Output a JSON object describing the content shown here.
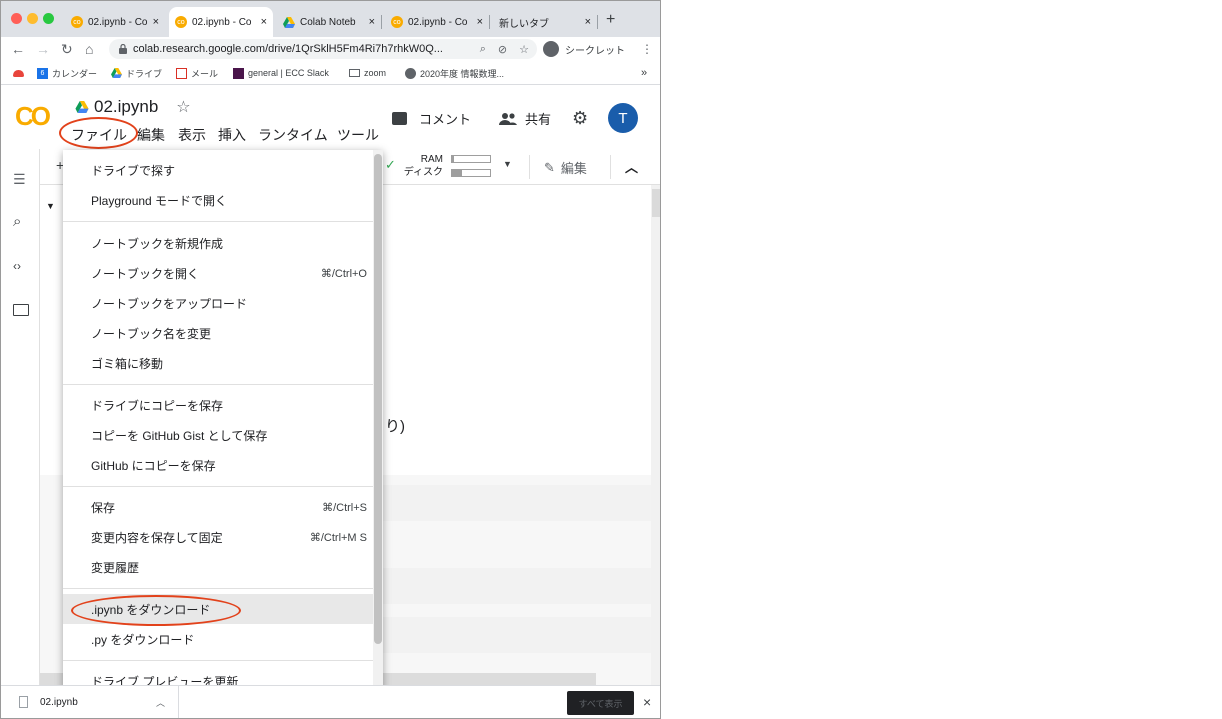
{
  "tabs": [
    {
      "title": "02.ipynb - Co",
      "favicon": "colab-icon",
      "active": false
    },
    {
      "title": "02.ipynb - Co",
      "favicon": "colab-icon",
      "active": true
    },
    {
      "title": "Colab Noteb",
      "favicon": "drive-icon",
      "active": false
    },
    {
      "title": "02.ipynb - Co",
      "favicon": "colab-icon",
      "active": false
    },
    {
      "title": "新しいタブ",
      "favicon": "",
      "active": false
    }
  ],
  "tab_close": "×",
  "new_tab": "+",
  "address": {
    "url": "colab.research.google.com/drive/1QrSklH5Fm4Ri7h7rhkW0Q...",
    "profile_label": "シークレット"
  },
  "bookmarks": [
    {
      "label": "",
      "icon": "cloud-icon"
    },
    {
      "label": "カレンダー",
      "icon": "calendar-icon"
    },
    {
      "label": "ドライブ",
      "icon": "drive-icon"
    },
    {
      "label": "メール",
      "icon": "gmail-icon"
    },
    {
      "label": "general | ECC Slack",
      "icon": "slack-icon"
    },
    {
      "label": "zoom",
      "icon": "folder-icon"
    },
    {
      "label": "2020年度 情報数理...",
      "icon": "globe-icon"
    }
  ],
  "bookmarks_more": "»",
  "colab": {
    "logo": "CO",
    "notebook_title": "02.ipynb",
    "menus": [
      "ファイル",
      "編集",
      "表示",
      "挿入",
      "ランタイム",
      "ツール"
    ],
    "comment_label": "コメント",
    "share_label": "共有",
    "avatar_letter": "T"
  },
  "toolbar": {
    "add": "+",
    "ram_label": "RAM",
    "disk_label": "ディスク",
    "edit_label": "編集"
  },
  "partial_text": "り)",
  "file_menu": {
    "items": [
      {
        "label": "ドライブで探す",
        "shortcut": ""
      },
      {
        "label": "Playground モードで開く",
        "shortcut": ""
      },
      {
        "label": "ノートブックを新規作成",
        "shortcut": ""
      },
      {
        "label": "ノートブックを開く",
        "shortcut": "⌘/Ctrl+O"
      },
      {
        "label": "ノートブックをアップロード",
        "shortcut": ""
      },
      {
        "label": "ノートブック名を変更",
        "shortcut": ""
      },
      {
        "label": "ゴミ箱に移動",
        "shortcut": ""
      },
      {
        "label": "ドライブにコピーを保存",
        "shortcut": ""
      },
      {
        "label": "コピーを GitHub Gist として保存",
        "shortcut": ""
      },
      {
        "label": "GitHub にコピーを保存",
        "shortcut": ""
      },
      {
        "label": "保存",
        "shortcut": "⌘/Ctrl+S"
      },
      {
        "label": "変更内容を保存して固定",
        "shortcut": "⌘/Ctrl+M S"
      },
      {
        "label": "変更履歴",
        "shortcut": ""
      },
      {
        "label": ".ipynb をダウンロード",
        "shortcut": ""
      },
      {
        "label": ".py をダウンロード",
        "shortcut": ""
      },
      {
        "label": "ドライブ プレビューを更新",
        "shortcut": ""
      }
    ]
  },
  "download_bar": {
    "file_name": "02.ipynb",
    "show_all": "すべて表示",
    "close": "×"
  },
  "colors": {
    "accent_highlight": "#e2421b",
    "colab_orange": "#f9ab00",
    "avatar_blue": "#1a5dab"
  }
}
